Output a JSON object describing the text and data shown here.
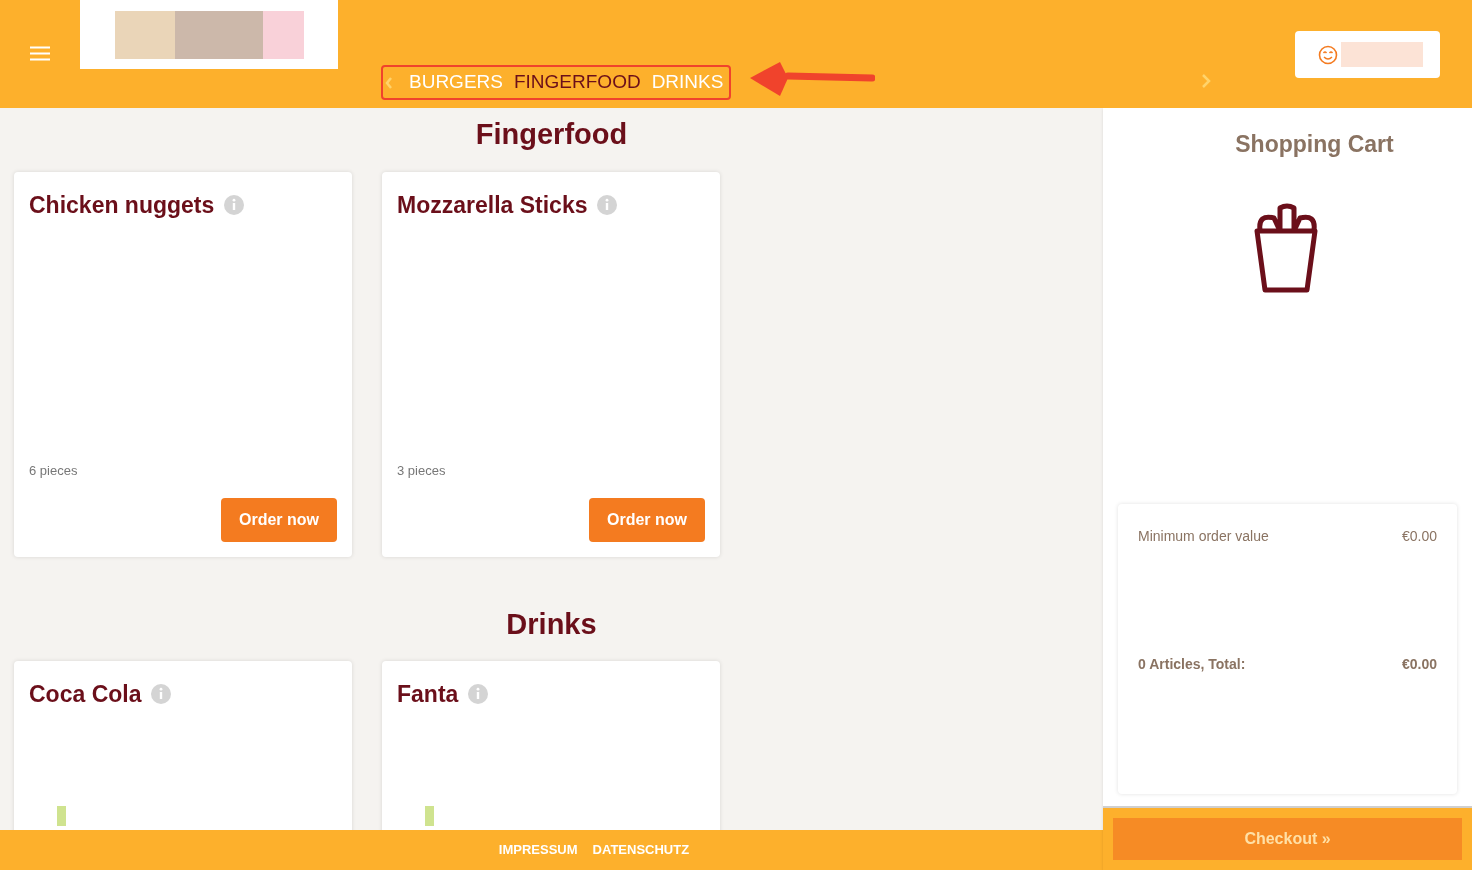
{
  "header": {
    "categories": [
      {
        "label": "BURGERS",
        "selected": false
      },
      {
        "label": "FINGERFOOD",
        "selected": true
      },
      {
        "label": "DRINKS",
        "selected": false
      }
    ]
  },
  "sections": [
    {
      "title": "Fingerfood",
      "products": [
        {
          "name": "Chicken nuggets",
          "description": "6 pieces",
          "button": "Order now"
        },
        {
          "name": "Mozzarella Sticks",
          "description": "3 pieces",
          "button": "Order now"
        }
      ]
    },
    {
      "title": "Drinks",
      "products": [
        {
          "name": "Coca Cola"
        },
        {
          "name": "Fanta"
        }
      ]
    }
  ],
  "cart": {
    "title": "Shopping Cart",
    "minimum_label": "Minimum order value",
    "minimum_value": "€0.00",
    "total_label": "0 Articles, Total:",
    "total_value": "€0.00",
    "checkout": "Checkout »"
  },
  "footer": {
    "links": [
      "IMPRESSUM",
      "DATENSCHUTZ"
    ]
  }
}
